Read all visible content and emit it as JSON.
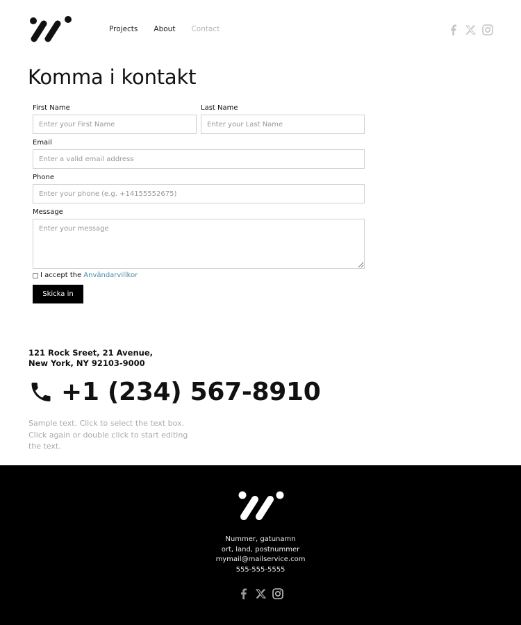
{
  "header": {
    "logo_name": "brand-logo",
    "nav": [
      {
        "label": "Projects",
        "active": false
      },
      {
        "label": "About",
        "active": false
      },
      {
        "label": "Contact",
        "active": true
      }
    ],
    "social": [
      "facebook-icon",
      "x-icon",
      "instagram-icon"
    ],
    "social_color": "#c4c4c4"
  },
  "main": {
    "title": "Komma i kontakt",
    "form": {
      "first_name": {
        "label": "First Name",
        "placeholder": "Enter your First Name",
        "value": ""
      },
      "last_name": {
        "label": "Last Name",
        "placeholder": "Enter your Last Name",
        "value": ""
      },
      "email": {
        "label": "Email",
        "placeholder": "Enter a valid email address",
        "value": ""
      },
      "phone": {
        "label": "Phone",
        "placeholder": "Enter your phone (e.g. +14155552675)",
        "value": ""
      },
      "message": {
        "label": "Message",
        "placeholder": "Enter your message",
        "value": ""
      },
      "terms": {
        "prefix": "I accept the",
        "link": "Användarvillkor",
        "checked": false
      },
      "submit_label": "Skicka in"
    },
    "address_line1": "121 Rock Sreet, 21 Avenue,",
    "address_line2": "New York, NY 92103-9000",
    "phone_number": "+1 (234) 567-8910",
    "sample_text": "Sample text. Click to select the text box. Click again or double click to start editing the text."
  },
  "footer": {
    "lines": [
      "Nummer, gatunamn",
      "ort, land, postnummer",
      "mymail@mailservice.com",
      "555-555-5555"
    ],
    "social": [
      "facebook-icon",
      "x-icon",
      "instagram-icon"
    ]
  },
  "colors": {
    "accent_link": "#4a8ba8",
    "button_bg": "#000000",
    "footer_bg": "#000000",
    "nav_active": "#b5b5b5"
  }
}
